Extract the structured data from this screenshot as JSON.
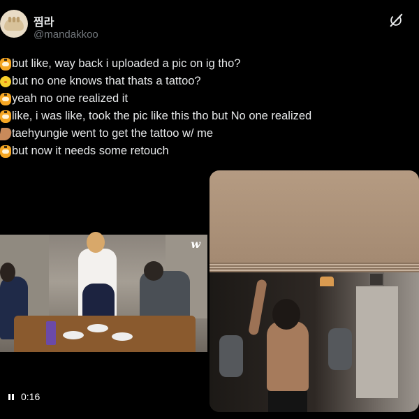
{
  "author": {
    "display_name": "찜라",
    "handle": "@mandakkoo",
    "avatar_icon": "dumpling-avatar-icon"
  },
  "header": {
    "grok_icon": "grok-icon"
  },
  "tweet_lines": [
    {
      "emoji": "tiger-emoji-icon",
      "text": "but like, way back i uploaded a pic on ig tho?"
    },
    {
      "emoji": "chick-emoji-icon",
      "text": "but no one knows that thats a tattoo?"
    },
    {
      "emoji": "tiger-emoji-icon",
      "text": "yeah no one realized it"
    },
    {
      "emoji": "tiger-emoji-icon",
      "text": "like, i was like, took the pic like this tho but No one realized"
    },
    {
      "emoji": "muscle-arm-emoji-icon",
      "text": "taehyungie went to get the tattoo w/ me"
    },
    {
      "emoji": "tiger-emoji-icon",
      "text": "but now it needs some retouch"
    }
  ],
  "video": {
    "time": "0:16",
    "watermark": "w",
    "control_icon": "pause-icon"
  },
  "colors": {
    "background": "#000000",
    "text": "#e7e9ea",
    "secondary": "#71767b"
  }
}
